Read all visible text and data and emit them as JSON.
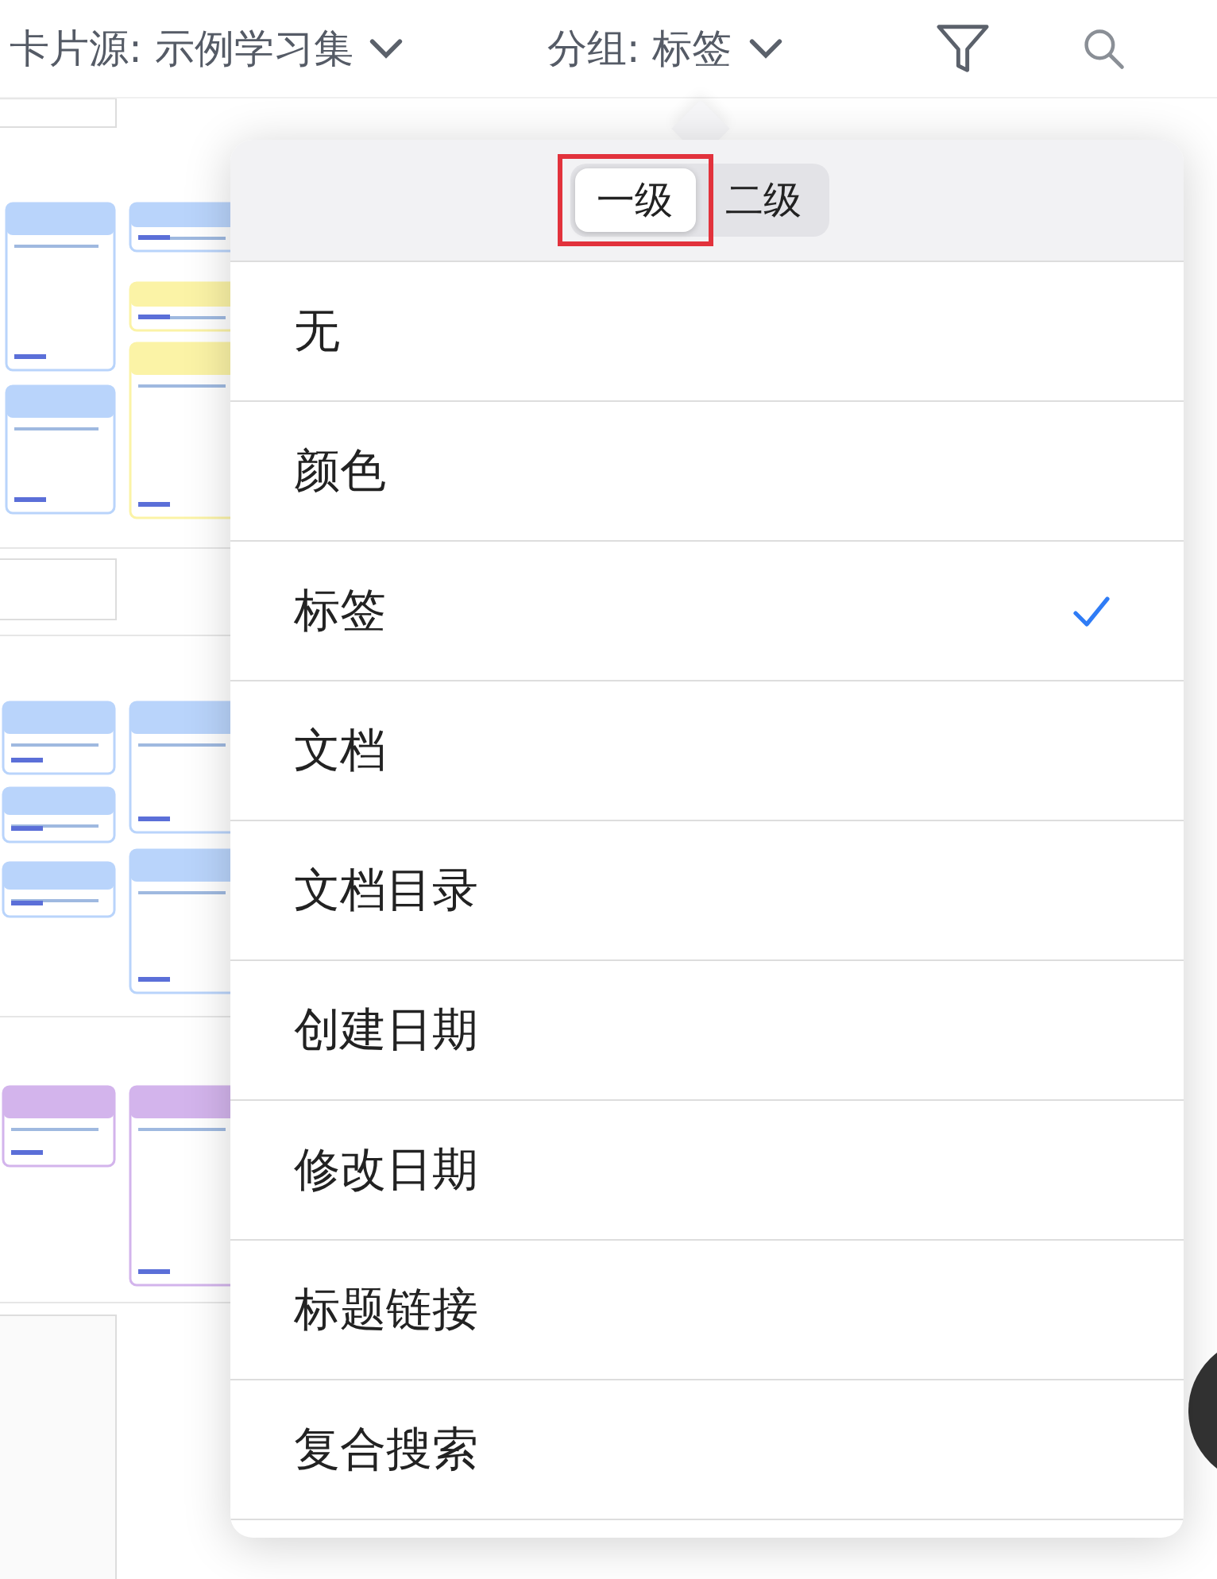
{
  "top_bar": {
    "card_source": "卡片源: 示例学习集",
    "group_by": "分组: 标签"
  },
  "group_popover": {
    "levels": [
      {
        "label": "一级",
        "selected": true,
        "highlighted": true
      },
      {
        "label": "二级",
        "selected": false,
        "highlighted": false
      }
    ],
    "options": [
      {
        "label": "无",
        "checked": false
      },
      {
        "label": "颜色",
        "checked": false
      },
      {
        "label": "标签",
        "checked": true
      },
      {
        "label": "文档",
        "checked": false
      },
      {
        "label": "文档目录",
        "checked": false
      },
      {
        "label": "创建日期",
        "checked": false
      },
      {
        "label": "修改日期",
        "checked": false
      },
      {
        "label": "标题链接",
        "checked": false
      },
      {
        "label": "复合搜索",
        "checked": false
      }
    ]
  }
}
